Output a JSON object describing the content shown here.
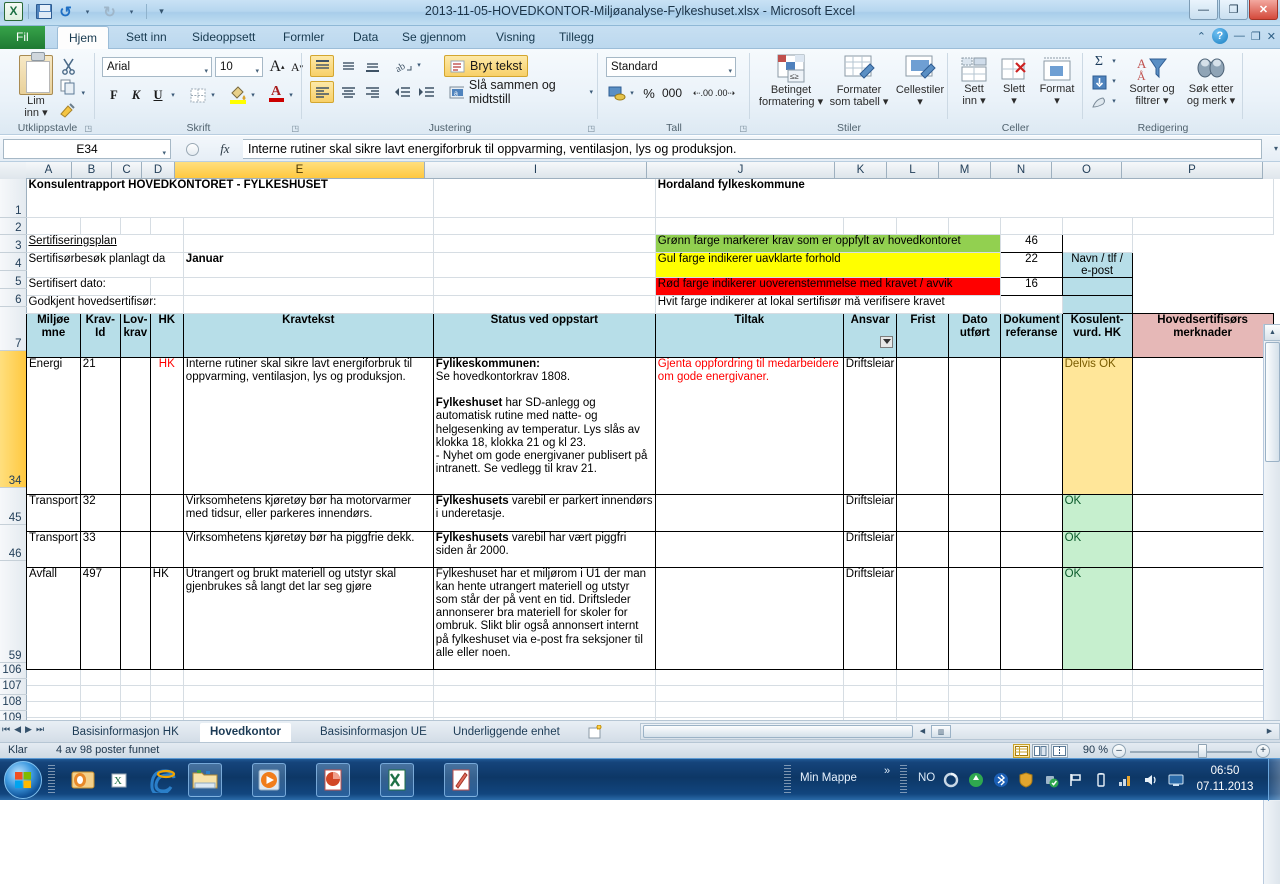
{
  "window": {
    "title": "2013-11-05-HOVEDKONTOR-Miljøanalyse-Fylkeshuset.xlsx  -  Microsoft Excel",
    "minimize": "—",
    "restore": "❐",
    "close": "✕"
  },
  "quick_access": {
    "save": "save-icon",
    "undo": "↺",
    "redo": "↻",
    "more": "▾"
  },
  "ribbon": {
    "tabs": [
      {
        "label": "Fil",
        "active": false,
        "file": true
      },
      {
        "label": "Hjem",
        "active": true
      },
      {
        "label": "Sett inn",
        "active": false
      },
      {
        "label": "Sideoppsett",
        "active": false
      },
      {
        "label": "Formler",
        "active": false
      },
      {
        "label": "Data",
        "active": false
      },
      {
        "label": "Se gjennom",
        "active": false
      },
      {
        "label": "Visning",
        "active": false
      },
      {
        "label": "Tillegg",
        "active": false
      }
    ],
    "help": {
      "collapse": "⌃",
      "question": "?",
      "minimize": "—",
      "restore": "❐",
      "close": "✕"
    },
    "groups": {
      "clipboard": {
        "label": "Utklippstavle",
        "paste": "Lim\ninn",
        "paste_line1": "Lim",
        "paste_line2": "inn ▾",
        "cut": "scissors-icon",
        "copy": "copy-icon",
        "format_painter": "brush-icon"
      },
      "font": {
        "label": "Skrift",
        "family": "Arial",
        "size": "10",
        "grow": "A",
        "shrink": "A",
        "bold": "F",
        "italic": "K",
        "underline": "U",
        "borders": "borders-icon",
        "fill": "fill-color-icon",
        "fontcolor": "A"
      },
      "alignment": {
        "label": "Justering",
        "wrap_text": "Bryt tekst",
        "merge_center": "Slå sammen og midtstill",
        "orientation": "orientation-icon",
        "decrease_indent": "decrease-indent-icon",
        "increase_indent": "increase-indent-icon"
      },
      "number": {
        "label": "Tall",
        "format": "Standard",
        "currency": "currency-icon",
        "percent": "%",
        "comma": "000",
        "inc_dec": ".00",
        "dec_dec": ".00"
      },
      "styles": {
        "label": "Stiler",
        "conditional_l1": "Betinget",
        "conditional_l2": "formatering ▾",
        "table_l1": "Formater",
        "table_l2": "som tabell ▾",
        "cellstyles_l1": "Cellestiler",
        "cellstyles_l2": "▾"
      },
      "cells": {
        "label": "Celler",
        "insert_l1": "Sett",
        "insert_l2": "inn ▾",
        "delete_l1": "Slett",
        "delete_l2": "▾",
        "format_l1": "Format",
        "format_l2": "▾"
      },
      "editing": {
        "label": "Redigering",
        "autosum": "Σ",
        "fill": "⬇",
        "clear": "eraser-icon",
        "sort_l1": "Sorter og",
        "sort_l2": "filtrer ▾",
        "find_l1": "Søk etter",
        "find_l2": "og merk ▾"
      }
    }
  },
  "formula_bar": {
    "name_box": "E34",
    "cancel": "✕",
    "confirm": "✓",
    "fx": "fx",
    "content": "Interne rutiner skal sikre lavt energiforbruk til oppvarming, ventilasjon, lys og produksjon."
  },
  "sheet": {
    "columns": [
      "A",
      "B",
      "C",
      "D",
      "E",
      "I",
      "J",
      "K",
      "L",
      "M",
      "N",
      "O",
      "P"
    ],
    "selected_column": "E",
    "row_numbers": [
      "1",
      "2",
      "3",
      "4",
      "5",
      "6",
      "7",
      "34",
      "45",
      "46",
      "59",
      "106",
      "107",
      "108",
      "109"
    ],
    "selected_row": "34",
    "titles": {
      "left": "Konsulentrapport HOVEDKONTORET - FYLKESHUSET",
      "right": "Hordaland fylkeskommune"
    },
    "info_rows": [
      {
        "label": "Sertifiseringsplan",
        "value": "",
        "underline": true
      },
      {
        "label": "Sertifisørbesøk planlagt da",
        "value": "Januar"
      },
      {
        "label": "Sertifisert dato:",
        "value": ""
      },
      {
        "label": "Godkjent hovedsertifisør:",
        "value": ""
      }
    ],
    "legend": [
      {
        "text": "Grønn farge markerer krav som er oppfylt av hovedkontoret",
        "color": "green",
        "count": "46",
        "contact": ""
      },
      {
        "text": "Gul farge indikerer uavklarte forhold",
        "color": "yellow",
        "count": "22",
        "contact": "Navn / tlf / e-post"
      },
      {
        "text": "Rød farge indikerer uoverenstemmelse med kravet / avvik",
        "color": "red",
        "count": "16",
        "contact": ""
      },
      {
        "text": "Hvit farge indikerer at lokal sertifisør må verifisere kravet",
        "color": "white",
        "count": "",
        "contact": ""
      }
    ],
    "headers": [
      {
        "l1": "Miljøe",
        "l2": "mne"
      },
      {
        "l1": "Krav-",
        "l2": "Id"
      },
      {
        "l1": "Lov-",
        "l2": "krav"
      },
      {
        "l1": "HK",
        "l2": ""
      },
      {
        "l1": "Kravtekst",
        "l2": ""
      },
      {
        "l1": "Status ved oppstart",
        "l2": ""
      },
      {
        "l1": "Tiltak",
        "l2": ""
      },
      {
        "l1": "Ansvar",
        "l2": "",
        "filter": true
      },
      {
        "l1": "Frist",
        "l2": ""
      },
      {
        "l1": "Dato",
        "l2": "utført"
      },
      {
        "l1": "Dokument",
        "l2": "referanse"
      },
      {
        "l1": "Kosulent-",
        "l2": "vurd. HK"
      },
      {
        "l1": "Hovedsertifisørs",
        "l2": "merknader",
        "pink": true
      }
    ],
    "rows": [
      {
        "row": "34",
        "selected": true,
        "miljoemne": "Energi",
        "krav_id": "21",
        "lovkrav": "",
        "hk": "HK",
        "hk_red": true,
        "kravtekst": "Interne rutiner skal sikre lavt energiforbruk til oppvarming, ventilasjon, lys og produksjon.",
        "status_parts": [
          {
            "text": "Fylikeskommunen:",
            "bold": true
          },
          {
            "text": "Se hovedkontorkrav 1808.",
            "bold": false
          },
          {
            "text": "",
            "bold": false
          },
          {
            "text": "Fylkeshuset",
            "bold": true,
            "inline": " har SD-anlegg og automatisk rutine med natte- og helgesenking av temperatur. Lys slås av klokka 18, klokka 21 og kl 23."
          },
          {
            "text": " - Nyhet om gode energivaner publisert på intranett. Se vedlegg til krav 21.",
            "bold": false
          }
        ],
        "tiltak": "Gjenta oppfordring til medarbeidere om gode energivaner.",
        "tiltak_red": true,
        "ansvar": "Driftsleiar",
        "frist": "",
        "dato_utfort": "",
        "dokument": "",
        "konsulent": "Delvis OK",
        "konsulent_color": "yellow",
        "merknader": ""
      },
      {
        "row": "45",
        "selected": false,
        "miljoemne": "Transport",
        "krav_id": "32",
        "lovkrav": "",
        "hk": "",
        "hk_red": false,
        "kravtekst": "Virksomhetens kjøretøy bør ha motorvarmer med tidsur, eller parkeres innendørs.",
        "status_parts": [
          {
            "text": "Fylkeshusets",
            "bold": true,
            "inline": " varebil er parkert innendørs i underetasje."
          }
        ],
        "tiltak": "",
        "tiltak_red": false,
        "ansvar": "Driftsleiar",
        "frist": "",
        "dato_utfort": "",
        "dokument": "",
        "konsulent": "OK",
        "konsulent_color": "green",
        "merknader": ""
      },
      {
        "row": "46",
        "selected": false,
        "miljoemne": "Transport",
        "krav_id": "33",
        "lovkrav": "",
        "hk": "",
        "hk_red": false,
        "kravtekst": "Virksomhetens kjøretøy bør ha piggfrie dekk.",
        "status_parts": [
          {
            "text": "Fylkeshusets",
            "bold": true,
            "inline": " varebil har vært piggfri siden år 2000."
          }
        ],
        "tiltak": "",
        "tiltak_red": false,
        "ansvar": "Driftsleiar",
        "frist": "",
        "dato_utfort": "",
        "dokument": "",
        "konsulent": "OK",
        "konsulent_color": "green",
        "merknader": ""
      },
      {
        "row": "59",
        "selected": false,
        "miljoemne": "Avfall",
        "krav_id": "497",
        "lovkrav": "",
        "hk": "HK",
        "hk_red": false,
        "kravtekst": "Utrangert og brukt materiell og utstyr skal gjenbrukes så langt det lar seg gjøre",
        "status_parts": [
          {
            "text": " Fylkeshuset har et miljørom i U1 der man kan hente utrangert materiell og utstyr som står der på vent en tid. Driftsleder annonserer bra materiell for skoler for ombruk. Slikt blir også annonsert internt på fylkeshuset via e-post fra seksjoner til alle eller noen.",
            "bold": false
          }
        ],
        "tiltak": "",
        "tiltak_red": false,
        "ansvar": "Driftsleiar",
        "frist": "",
        "dato_utfort": "",
        "dokument": "",
        "konsulent": "OK",
        "konsulent_color": "green",
        "merknader": ""
      }
    ],
    "empty_rows": [
      "106",
      "107",
      "108",
      "109"
    ]
  },
  "sheet_tabs": {
    "nav": [
      "⏮",
      "◀",
      "▶",
      "⏭"
    ],
    "tabs": [
      {
        "label": "Basisinformasjon HK",
        "active": false
      },
      {
        "label": "Hovedkontor",
        "active": true
      },
      {
        "label": "Basisinformasjon UE",
        "active": false
      },
      {
        "label": "Underliggende enhet",
        "active": false
      }
    ],
    "new_sheet": "new-sheet-icon"
  },
  "status_bar": {
    "state": "Klar",
    "records": "4 av 98 poster funnet",
    "views": [
      "normal-view",
      "page-layout-view",
      "page-break-view"
    ],
    "zoom": "90 %",
    "zoom_out": "–",
    "zoom_in": "+"
  },
  "taskbar": {
    "start": "windows-start-orb",
    "items": [
      "outlook-icon",
      "internet-explorer-icon",
      "explorer-icon",
      "media-player-icon",
      "powerpoint-icon",
      "excel-icon",
      "image-editor-icon"
    ],
    "min_mappe": "Min Mappe",
    "overflow": "»",
    "language": "NO",
    "tray": [
      "sync-icon",
      "recycle-icon",
      "bluetooth-icon",
      "shield-icon",
      "plug-ok-icon",
      "flag-icon",
      "battery-icon",
      "network-icon",
      "volume-icon",
      "display-icon"
    ],
    "time": "06:50",
    "date": "07.11.2013"
  }
}
